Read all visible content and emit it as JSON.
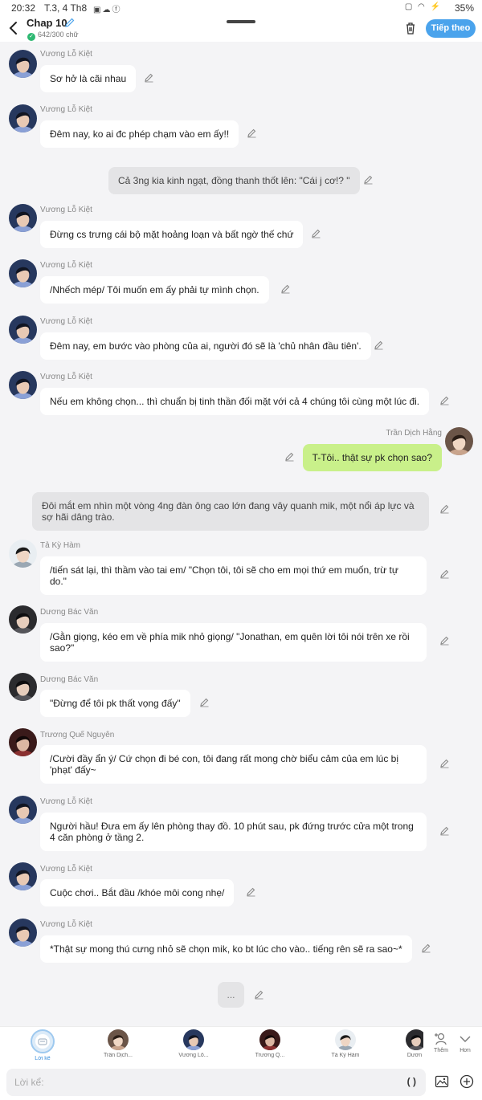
{
  "status_bar": {
    "time": "20:32",
    "date": "T.3, 4 Th8",
    "battery": "35%"
  },
  "header": {
    "title": "Chap 10",
    "counter": "642/300 chữ",
    "follow_label": "Tiếp theo"
  },
  "messages": [
    {
      "kind": "left",
      "name": "Vương Lỗ Kiệt",
      "avatar": "kiet",
      "text": "Sơ hở là cãi nhau"
    },
    {
      "kind": "left",
      "name": "Vương Lỗ Kiệt",
      "avatar": "kiet",
      "text": "Đêm nay, ko ai đc phép chạm vào em ấy!!"
    },
    {
      "kind": "narr",
      "text": "Cả 3ng kia kinh ngạt, đồng thanh thốt lên: \"Cái j cơ!? \""
    },
    {
      "kind": "left",
      "name": "Vương Lỗ Kiệt",
      "avatar": "kiet",
      "text": "Đừng cs trưng cái bộ mặt hoảng loạn và bất ngờ thế chứ"
    },
    {
      "kind": "left",
      "name": "Vương Lỗ Kiệt",
      "avatar": "kiet",
      "text": "/Nhếch mép/ Tôi muốn em ấy phải tự mình chọn."
    },
    {
      "kind": "left",
      "name": "Vương Lỗ Kiệt",
      "avatar": "kiet",
      "text": "Đêm nay, em bước vào phòng của ai, người đó sẽ là 'chủ nhân đầu tiên'."
    },
    {
      "kind": "left",
      "name": "Vương Lỗ Kiệt",
      "avatar": "kiet",
      "text": "Nếu em không chọn... thì chuẩn bị tinh thần đối mặt với cả 4 chúng tôi cùng một lúc đi."
    },
    {
      "kind": "right",
      "name": "Trần Dịch Hằng",
      "avatar": "hang",
      "text": "T-Tôi.. thật sự pk chọn sao?"
    },
    {
      "kind": "narr",
      "text": "Đôi mắt em nhìn một vòng 4ng đàn ông cao lớn đang vây quanh mik, một nổi áp lực và sợ hãi dâng trào."
    },
    {
      "kind": "left",
      "name": "Tả Kỳ Hàm",
      "avatar": "ham",
      "text": "/tiến sát lại, thì thầm vào tai em/ \"Chọn tôi, tôi sẽ cho em mọi thứ em muốn, trừ tự do.\""
    },
    {
      "kind": "left",
      "name": "Dương Bác Văn",
      "avatar": "van",
      "text": "/Gằn giọng, kéo em về phía mik nhỏ giọng/ \"Jonathan, em quên lời tôi nói trên xe rồi sao?\""
    },
    {
      "kind": "left",
      "name": "Dương Bác Văn",
      "avatar": "van",
      "text": "\"Đừng để tôi pk thất vọng đấy\""
    },
    {
      "kind": "left",
      "name": "Trương Quế Nguyên",
      "avatar": "nguyen",
      "text": "/Cười đầy ẩn ý/ Cứ chọn đi bé con, tôi đang rất mong chờ biểu cảm của em lúc bị 'phạt' đấy~"
    },
    {
      "kind": "left",
      "name": "Vương Lỗ Kiệt",
      "avatar": "kiet",
      "text": "Người hầu! Đưa em ấy lên phòng thay đồ. 10 phút sau, pk đứng trước cửa một trong 4 căn phòng ở tầng 2."
    },
    {
      "kind": "left",
      "name": "Vương Lỗ Kiệt",
      "avatar": "kiet",
      "text": "Cuộc chơi.. Bắt đầu /khóe môi cong nhẹ/"
    },
    {
      "kind": "left",
      "name": "Vương Lỗ Kiệt",
      "avatar": "kiet",
      "text": "*Thật sự mong thú cưng nhỏ sẽ chọn mik, ko bt lúc cho vào.. tiếng rên sẽ ra sao~*"
    },
    {
      "kind": "narr",
      "text": "..."
    }
  ],
  "characters": [
    {
      "label": "Lời kể",
      "selected": true
    },
    {
      "label": "Trần Dịch...",
      "avatar": "hang"
    },
    {
      "label": "Vương Lỗ...",
      "avatar": "kiet"
    },
    {
      "label": "Trương Q...",
      "avatar": "nguyen"
    },
    {
      "label": "Tả Kỳ Hàm",
      "avatar": "ham"
    },
    {
      "label": "Dươn",
      "avatar": "van"
    }
  ],
  "tools": {
    "add_label": "Thêm",
    "more_label": "Hơn"
  },
  "input": {
    "placeholder": "Lời kể:",
    "paren": "( )"
  },
  "colors": {
    "accent": "#4aa3ec",
    "self_bubble": "#c9f08a",
    "narration_bubble": "#e4e4e6",
    "background": "#f4f4f6"
  }
}
